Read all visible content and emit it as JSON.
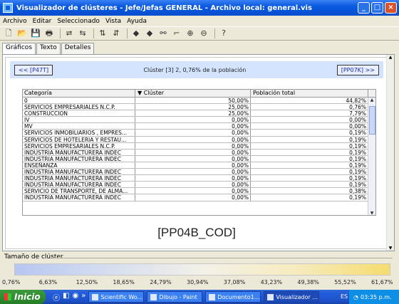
{
  "window": {
    "title": "Visualizador de clústeres - Jefe/Jefas GENERAL - Archivo local: general.vis"
  },
  "menu": [
    "Archivo",
    "Editar",
    "Seleccionado",
    "Vista",
    "Ayuda"
  ],
  "toolbar_icons": [
    "new-icon",
    "open-icon",
    "save-icon",
    "print-icon",
    "redo-icon",
    "swap-icon",
    "sort-asc-icon",
    "sort-desc-icon",
    "diamond-left-icon",
    "diamond-right-icon",
    "binoculars-icon",
    "chart-icon",
    "zoom-in-icon",
    "zoom-out-icon",
    "help-icon"
  ],
  "tabs": [
    {
      "label": "Gráficos",
      "active": true
    },
    {
      "label": "Texto"
    },
    {
      "label": "Detalles"
    }
  ],
  "nav": {
    "prev": "<< [P47T]",
    "title": "Clúster [3] 2, 0,76% de la población",
    "next": "[PP07K] >>"
  },
  "table": {
    "columns": [
      "Categoría",
      "▼ Clúster",
      "Población total"
    ],
    "rows": [
      [
        "0",
        "50,00%",
        "44,82%"
      ],
      [
        "SERVICIOS EMPRESARIALES N.C.P.",
        "25,00%",
        "0,76%"
      ],
      [
        "CONSTRUCCION",
        "25,00%",
        "7,79%"
      ],
      [
        "IV",
        "0,00%",
        "0,00%"
      ],
      [
        "MV",
        "0,00%",
        "0,00%"
      ],
      [
        "SERVICIOS INMOBILIARIOS , EMPRES...",
        "0,00%",
        "0,19%"
      ],
      [
        "SERVICIOS DE HOTELERIA Y RESTAU...",
        "0,00%",
        "0,19%"
      ],
      [
        "SERVICIOS EMPRESARIALES N.C.P.",
        "0,00%",
        "0,19%"
      ],
      [
        "INDUSTRIA MANUFACTURERA INDEC",
        "0,00%",
        "0,19%"
      ],
      [
        "INDUSTRIA MANUFACTURERA INDEC",
        "0,00%",
        "0,19%"
      ],
      [
        "ENSEÑANZA",
        "0,00%",
        "0,19%"
      ],
      [
        "INDUSTRIA MANUFACTURERA INDEC",
        "0,00%",
        "0,19%"
      ],
      [
        "INDUSTRIA MANUFACTURERA INDEC",
        "0,00%",
        "0,19%"
      ],
      [
        "INDUSTRIA MANUFACTURERA INDEC",
        "0,00%",
        "0,19%"
      ],
      [
        "SERVICIO DE TRANSPORTE, DE ALMA...",
        "0,00%",
        "0,38%"
      ],
      [
        "INDUSTRIA MANUFACTURERA INDEC",
        "0,00%",
        "0,19%"
      ]
    ]
  },
  "variable_label": "[PP04B_COD]",
  "cluster_size": {
    "label": "Tamaño de clúster",
    "ticks": [
      "0,76%",
      "6,63%",
      "12,50%",
      "18,65%",
      "24,79%",
      "30,94%",
      "37,08%",
      "43,23%",
      "49,38%",
      "55,52%",
      "61,67%"
    ]
  },
  "taskbar": {
    "start": "Inicio",
    "tasks": [
      {
        "label": "Scientific Wo..."
      },
      {
        "label": "Dibujo - Paint"
      },
      {
        "label": "Documento1..."
      },
      {
        "label": "Visualizador ...",
        "active": true
      }
    ],
    "lang": "ES",
    "time": "03:35 p.m."
  }
}
